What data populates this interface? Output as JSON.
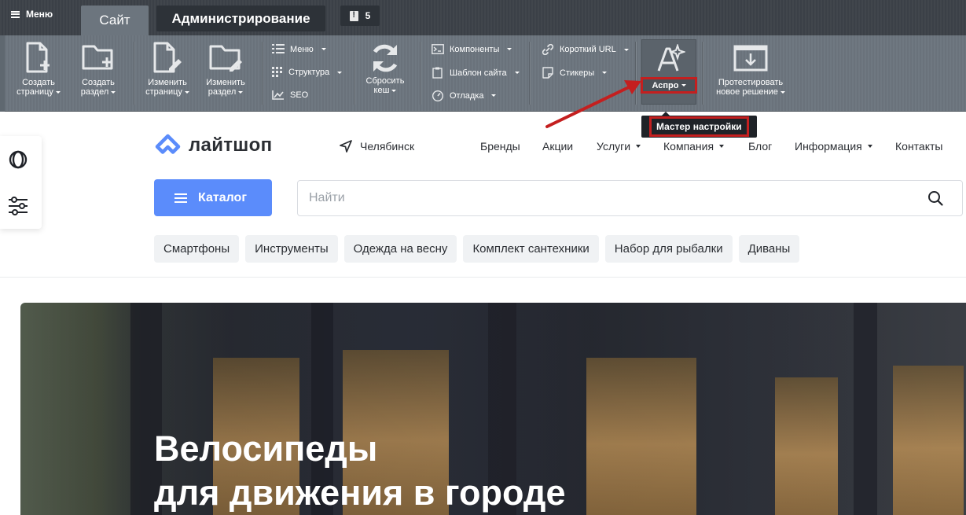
{
  "admin": {
    "menu_label": "Меню",
    "tab_site": "Сайт",
    "tab_admin": "Администрирование",
    "notifications_count": "5",
    "toolbar": {
      "create_page": [
        "Создать",
        "страницу"
      ],
      "create_section": [
        "Создать",
        "раздел"
      ],
      "edit_page": [
        "Изменить",
        "страницу"
      ],
      "edit_section": [
        "Изменить",
        "раздел"
      ],
      "menu": "Меню",
      "structure": "Структура",
      "seo": "SEO",
      "clear_cache": [
        "Сбросить",
        "кеш"
      ],
      "components": "Компоненты",
      "site_template": "Шаблон сайта",
      "debug": "Отладка",
      "short_url": "Короткий URL",
      "stickers": "Стикеры",
      "aspro": "Аспро",
      "test_solution": [
        "Протестировать",
        "новое решение"
      ]
    },
    "tooltip": "Мастер настройки",
    "colors": {
      "highlight": "#c41f1f"
    }
  },
  "site": {
    "logo": "лайтшоп",
    "city": "Челябинск",
    "nav": [
      "Бренды",
      "Акции",
      "Услуги",
      "Компания",
      "Блог",
      "Информация",
      "Контакты"
    ],
    "catalog_label": "Каталог",
    "search_placeholder": "Найти",
    "chips": [
      "Смартфоны",
      "Инструменты",
      "Одежда на весну",
      "Комплект сантехники",
      "Набор для рыбалки",
      "Диваны"
    ],
    "hero": {
      "line1": "Велосипеды",
      "line2": "для движения в городе"
    },
    "colors": {
      "accent": "#5b8cfb"
    }
  }
}
